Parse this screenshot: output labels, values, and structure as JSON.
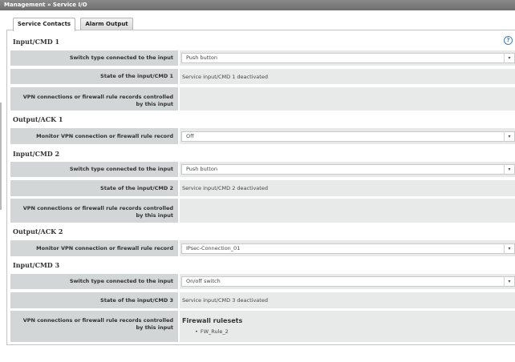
{
  "titlebar": {
    "breadcrumb": "Management » Service I/O"
  },
  "tabs": [
    {
      "label": "Service Contacts",
      "active": true
    },
    {
      "label": "Alarm Output",
      "active": false
    }
  ],
  "help_icon": "?",
  "sections": {
    "input1": {
      "title": "Input/CMD 1",
      "switch_label": "Switch type connected to the input",
      "switch_value": "Push button",
      "state_label": "State of the input/CMD 1",
      "state_value": "Service input/CMD 1 deactivated",
      "vpn_label_line1": "VPN connections or firewall rule records controlled",
      "vpn_label_line2": "by this input"
    },
    "output1": {
      "title": "Output/ACK 1",
      "monitor_label": "Monitor VPN connection or firewall rule record",
      "monitor_value": "Off"
    },
    "input2": {
      "title": "Input/CMD 2",
      "switch_label": "Switch type connected to the input",
      "switch_value": "Push button",
      "state_label": "State of the input/CMD 2",
      "state_value": "Service input/CMD 2 deactivated",
      "vpn_label_line1": "VPN connections or firewall rule records controlled",
      "vpn_label_line2": "by this input"
    },
    "output2": {
      "title": "Output/ACK 2",
      "monitor_label": "Monitor VPN connection or firewall rule record",
      "monitor_value": "IPsec-Connection_01"
    },
    "input3": {
      "title": "Input/CMD 3",
      "switch_label": "Switch type connected to the input",
      "switch_value": "On/off switch",
      "state_label": "State of the input/CMD 3",
      "state_value": "Service input/CMD 3 deactivated",
      "vpn_label_line1": "VPN connections or firewall rule records controlled",
      "vpn_label_line2": "by this input",
      "firewall_title": "Firewall rulesets",
      "firewall_items": [
        "FW_Rule_2"
      ]
    }
  },
  "icons": {
    "dropdown": "chevron-down-icon",
    "help": "help-icon"
  },
  "colors": {
    "label_bg": "#d3d6d7",
    "value_bg": "#e8eaea",
    "titlebar": "#7a7a7a",
    "help": "#3d7fbf"
  }
}
